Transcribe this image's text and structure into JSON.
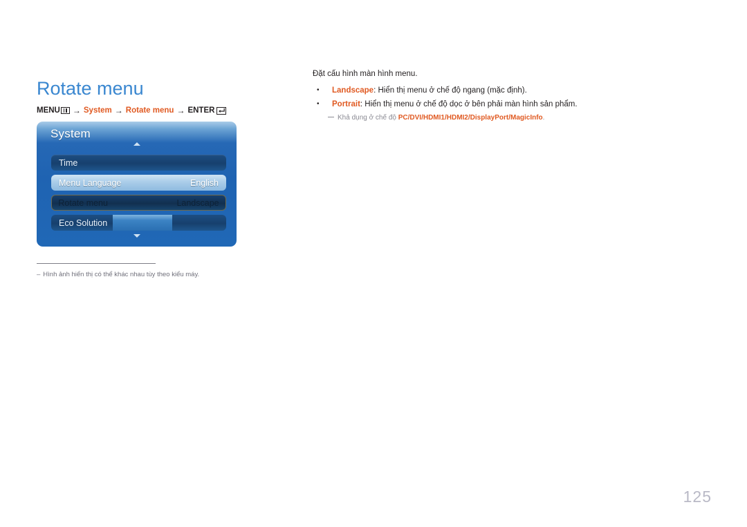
{
  "page": {
    "title": "Rotate menu",
    "number": "125",
    "accent_color": "#e05a22",
    "title_color": "#3a87d0"
  },
  "breadcrumb": {
    "menu_label": "MENU",
    "menu_icon": "menu-keypad-icon",
    "arrow": "→",
    "segments": [
      {
        "text": "System",
        "accent": true
      },
      {
        "text": "Rotate menu",
        "accent": true
      }
    ],
    "enter_label": "ENTER",
    "enter_icon": "enter-return-icon"
  },
  "osd": {
    "title": "System",
    "scroll_up_icon": "triangle-up-icon",
    "scroll_down_icon": "triangle-down-icon",
    "rows": [
      {
        "label": "Time",
        "value": "",
        "state": "normal"
      },
      {
        "label": "Menu Language",
        "value": "English",
        "state": "selected"
      },
      {
        "label": "Rotate menu",
        "value": "Landscape",
        "state": "focused"
      },
      {
        "label": "Eco Solution",
        "value": "",
        "state": "bar"
      }
    ]
  },
  "left_footnote": {
    "dash": "‒",
    "text": "Hình ảnh hiển thị có thể khác nhau tùy theo kiểu máy."
  },
  "content": {
    "intro": "Đặt cấu hình màn hình menu.",
    "bullets": [
      {
        "term": "Landscape",
        "rest": ": Hiển thị menu ở chế độ ngang (mặc định)."
      },
      {
        "term": "Portrait",
        "rest": ": Hiển thị menu ở chế độ dọc ở bên phải màn hình sản phẩm."
      }
    ],
    "subnote": {
      "prefix": "Khả dụng ở chế độ ",
      "modes": "PC/DVI/HDMI1/HDMI2/DisplayPort/MagicInfo",
      "suffix": "."
    }
  }
}
